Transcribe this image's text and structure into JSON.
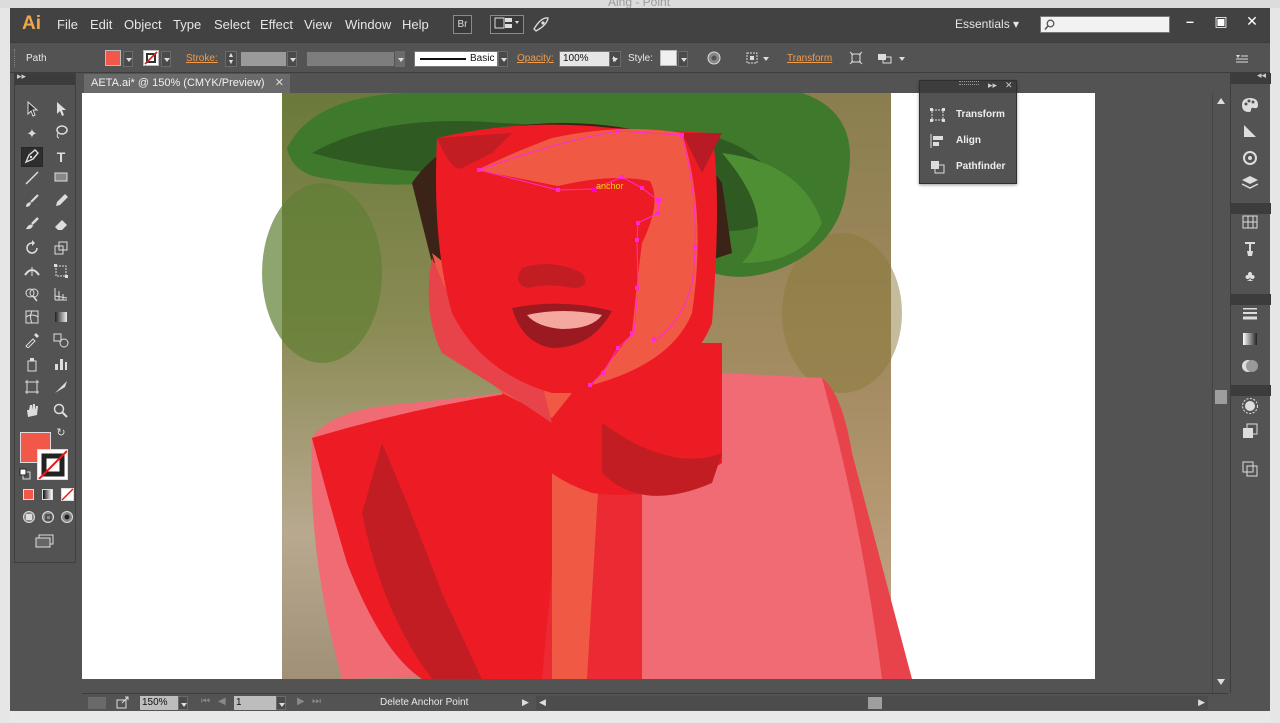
{
  "window": {
    "title_fragment": "Aing - Point"
  },
  "menubar": {
    "logo": "Ai",
    "items": [
      "File",
      "Edit",
      "Object",
      "Type",
      "Select",
      "Effect",
      "View",
      "Window",
      "Help"
    ],
    "bridge_label": "Br",
    "workspace": "Essentials"
  },
  "controlbar": {
    "selection_type": "Path",
    "stroke_label": "Stroke:",
    "brush_style": "Basic",
    "opacity_label": "Opacity:",
    "opacity_value": "100%",
    "style_label": "Style:",
    "transform_link": "Transform",
    "fill_color": "#f1584a"
  },
  "document": {
    "tab_label": "AETA.ai* @ 150% (CMYK/Preview)",
    "anchor_hint": "anchor"
  },
  "float_panel": {
    "items": [
      "Transform",
      "Align",
      "Pathfinder"
    ]
  },
  "statusbar": {
    "zoom": "150%",
    "artboard": "1",
    "status_text": "Delete Anchor Point"
  },
  "colors": {
    "ui_bg": "#535353",
    "menubar_bg": "#424242",
    "accent_orange": "#f29c4a",
    "selection_magenta": "#ff2ad4"
  }
}
